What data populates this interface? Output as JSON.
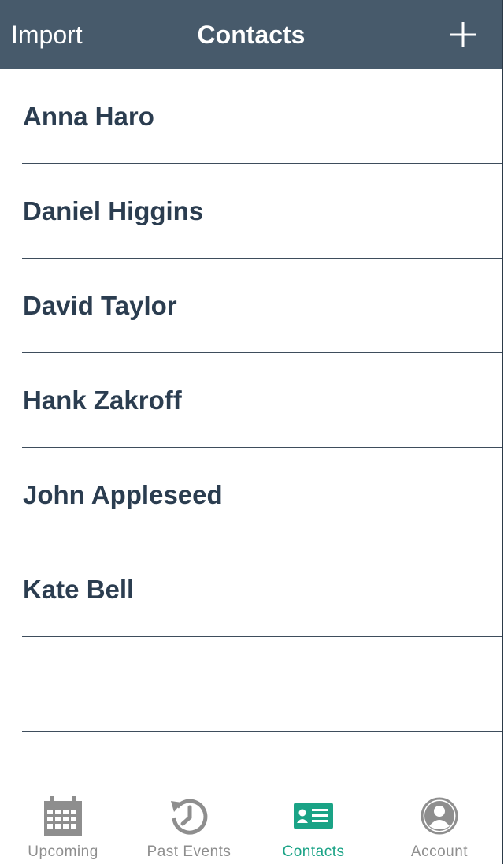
{
  "navbar": {
    "left_label": "Import",
    "title": "Contacts"
  },
  "contacts": [
    {
      "name": "Anna Haro"
    },
    {
      "name": "Daniel Higgins"
    },
    {
      "name": "David Taylor"
    },
    {
      "name": "Hank Zakroff"
    },
    {
      "name": "John Appleseed"
    },
    {
      "name": "Kate Bell"
    },
    {
      "name": ""
    }
  ],
  "tabbar": {
    "tabs": [
      {
        "label": "Upcoming",
        "icon": "calendar-icon",
        "active": false
      },
      {
        "label": "Past Events",
        "icon": "history-icon",
        "active": false
      },
      {
        "label": "Contacts",
        "icon": "contact-card-icon",
        "active": true
      },
      {
        "label": "Account",
        "icon": "account-icon",
        "active": false
      }
    ]
  },
  "colors": {
    "navbar_bg": "#475a6b",
    "text_dark": "#2b3d50",
    "tab_inactive": "#8e8e8e",
    "tab_active": "#1aa386"
  }
}
